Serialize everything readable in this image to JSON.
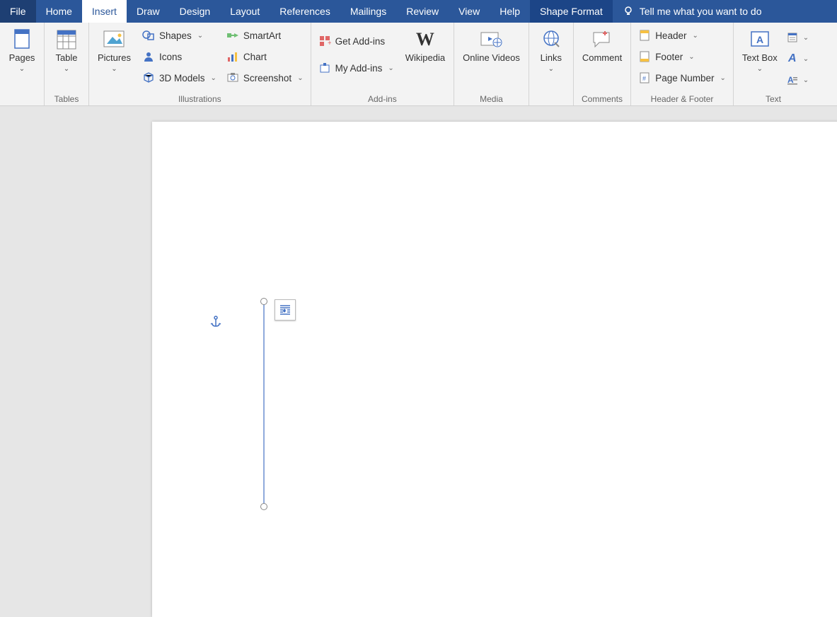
{
  "tabs": {
    "file": "File",
    "home": "Home",
    "insert": "Insert",
    "draw": "Draw",
    "design": "Design",
    "layout": "Layout",
    "references": "References",
    "mailings": "Mailings",
    "review": "Review",
    "view": "View",
    "help": "Help",
    "shape_format": "Shape Format",
    "tellme": "Tell me what you want to do"
  },
  "ribbon": {
    "pages": {
      "label": "Pages"
    },
    "tables": {
      "label": "Tables",
      "table": "Table"
    },
    "illustrations": {
      "label": "Illustrations",
      "pictures": "Pictures",
      "shapes": "Shapes",
      "icons": "Icons",
      "models": "3D Models",
      "smartart": "SmartArt",
      "chart": "Chart",
      "screenshot": "Screenshot"
    },
    "addins": {
      "label": "Add-ins",
      "get": "Get Add-ins",
      "my": "My Add-ins",
      "wikipedia": "Wikipedia"
    },
    "media": {
      "label": "Media",
      "online_videos": "Online Videos"
    },
    "links": {
      "label": "",
      "links": "Links"
    },
    "comments": {
      "label": "Comments",
      "comment": "Comment"
    },
    "headerfooter": {
      "label": "Header & Footer",
      "header": "Header",
      "footer": "Footer",
      "page_number": "Page Number"
    },
    "text": {
      "label": "Text",
      "textbox": "Text Box"
    }
  },
  "canvas": {
    "shape_type": "line",
    "selected": true
  }
}
